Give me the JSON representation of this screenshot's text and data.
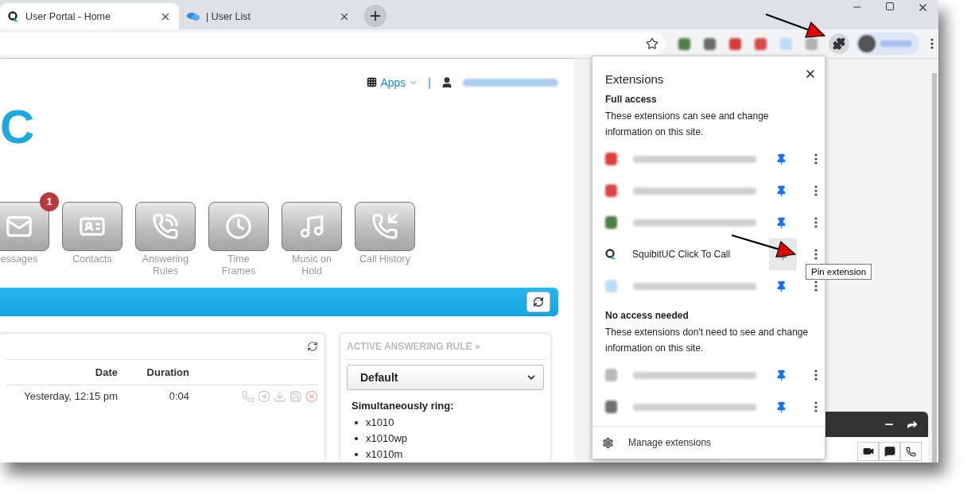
{
  "tabs": [
    {
      "title": "User Portal - Home",
      "kind": "portal",
      "selected": true
    },
    {
      "title": "| User List",
      "kind": "chat",
      "selected": false
    }
  ],
  "toolbar_extensions": [
    {
      "color": "#4f7d43"
    },
    {
      "color": "#6b6b6b"
    },
    {
      "color": "#d43b3b"
    },
    {
      "color": "#d94848"
    },
    {
      "color": "#bcdcf5"
    },
    {
      "color": "#b0b0b0"
    }
  ],
  "header": {
    "apps": "Apps",
    "separator": "|"
  },
  "logo": {
    "text": "C"
  },
  "features": [
    {
      "kind": "mail",
      "lines": [
        "essages"
      ],
      "badge": "1"
    },
    {
      "kind": "contacts",
      "lines": [
        "Contacts"
      ]
    },
    {
      "kind": "answering",
      "lines": [
        "Answering",
        "Rules"
      ]
    },
    {
      "kind": "time",
      "lines": [
        "Time",
        "Frames"
      ]
    },
    {
      "kind": "music",
      "lines": [
        "Music on",
        "Hold"
      ]
    },
    {
      "kind": "history",
      "lines": [
        "Call History"
      ]
    }
  ],
  "calls": {
    "columns": [
      "Date",
      "Duration"
    ],
    "rows": [
      {
        "date": "Yesterday, 12:15 pm",
        "duration": "0:04"
      }
    ]
  },
  "answering_rule": {
    "title": "ACTIVE ANSWERING RULE »",
    "selected": "Default",
    "ring_label": "Simultaneously ring:",
    "ring": [
      "x1010",
      "x1010wp",
      "x1010m"
    ]
  },
  "extensions_popup": {
    "title": "Extensions",
    "manage": "Manage extensions",
    "tooltip": "Pin extension",
    "sections": [
      {
        "heading": "Full access",
        "description": "These extensions can see and change information on this site.",
        "items": [
          {
            "color": "#d9403f",
            "pinned": true,
            "blurred": true,
            "hovered": false
          },
          {
            "color": "#d94848",
            "pinned": true,
            "blurred": true,
            "hovered": false
          },
          {
            "color": "#4f7d43",
            "pinned": true,
            "blurred": true,
            "hovered": false
          },
          {
            "name": "SquibitUC Click To Call",
            "color": "#333333",
            "pinned": false,
            "blurred": false,
            "hovered": true
          },
          {
            "color": "#bcdcf5",
            "pinned": true,
            "blurred": true,
            "hovered": false
          }
        ]
      },
      {
        "heading": "No access needed",
        "description": "These extensions don't need to see and change information on this site.",
        "items": [
          {
            "color": "#b8b8b8",
            "pinned": true,
            "blurred": true,
            "hovered": false
          },
          {
            "color": "#6f6f6f",
            "pinned": true,
            "blurred": true,
            "hovered": false
          }
        ]
      }
    ]
  }
}
